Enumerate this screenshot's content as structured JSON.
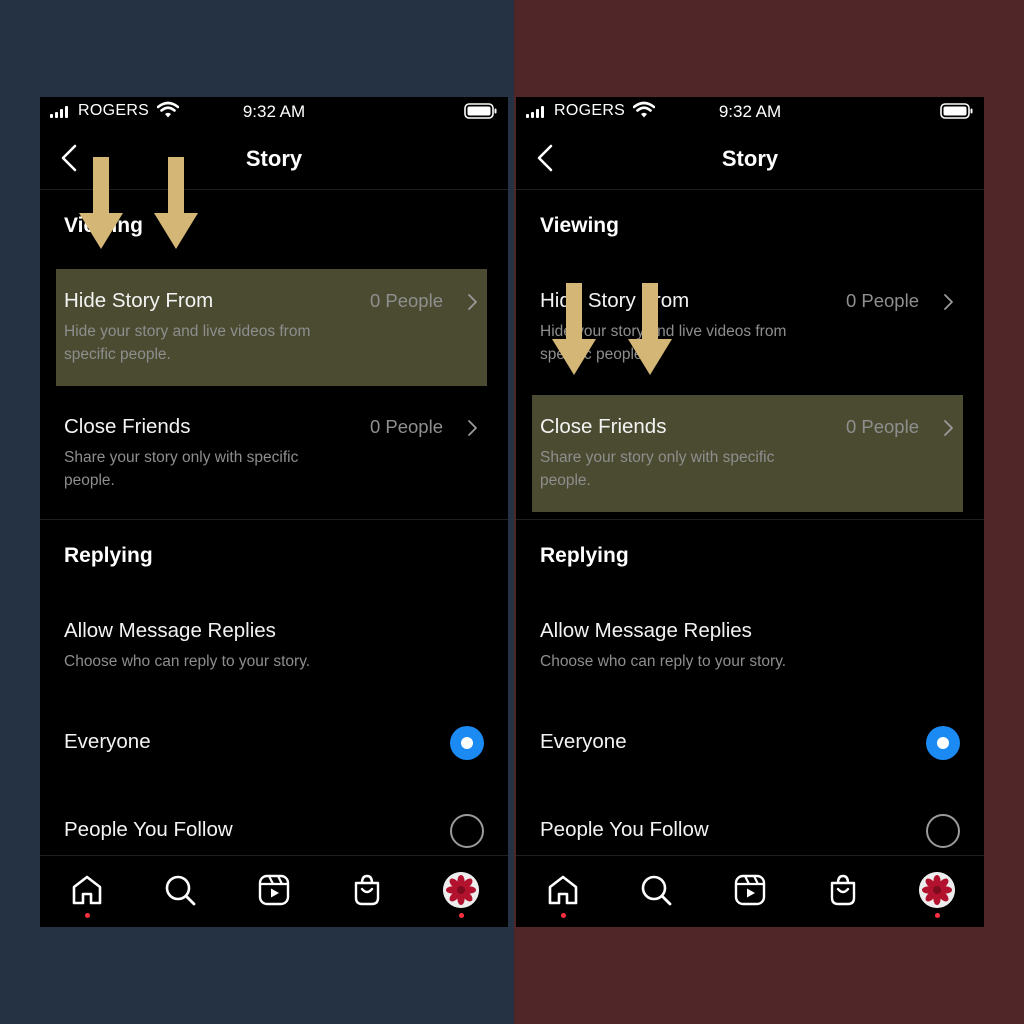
{
  "status": {
    "carrier": "ROGERS",
    "time": "9:32 AM"
  },
  "header": {
    "title": "Story"
  },
  "sections": {
    "viewing": "Viewing",
    "replying": "Replying"
  },
  "rows": {
    "hide_story": {
      "title": "Hide Story From",
      "desc": "Hide your story and live videos from specific people.",
      "count": "0 People"
    },
    "close_friends": {
      "title": "Close Friends",
      "desc": "Share your story only with specific people.",
      "count": "0 People"
    }
  },
  "replies": {
    "title": "Allow Message Replies",
    "desc": "Choose who can reply to your story.",
    "options": [
      "Everyone",
      "People You Follow"
    ],
    "selected": "Everyone"
  },
  "tabs": [
    "home-icon",
    "search-icon",
    "reels-icon",
    "shop-icon",
    "profile-avatar"
  ],
  "colors": {
    "left_background": "#253244",
    "right_background": "#512628",
    "highlight": "#4b4b31",
    "arrow": "#d4b676",
    "radio_on": "#1b8af3",
    "notification_dot": "#ff3040"
  },
  "annotations": {
    "left_highlighted_row": "Hide Story From",
    "right_highlighted_row": "Close Friends"
  }
}
